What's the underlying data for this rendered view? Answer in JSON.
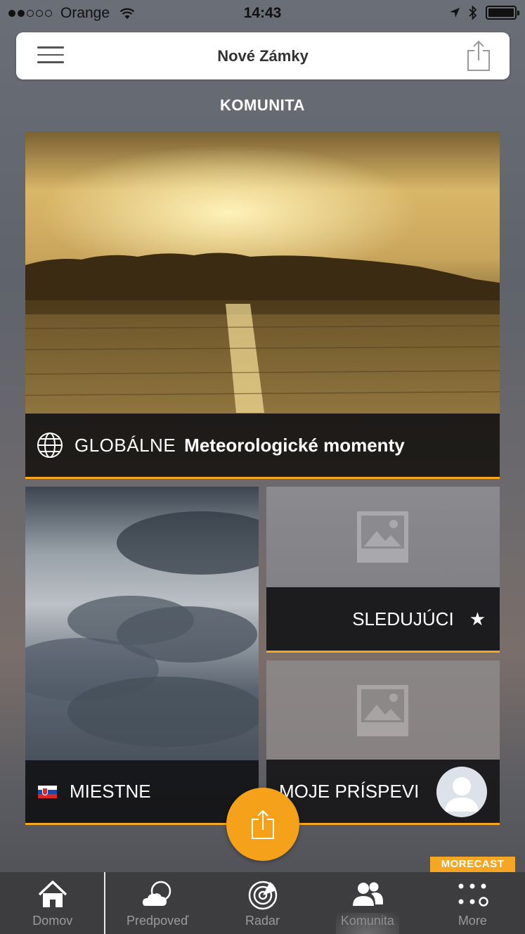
{
  "status_bar": {
    "carrier": "Orange",
    "time": "14:43"
  },
  "header": {
    "title": "Nové Zámky",
    "menu_icon": "hamburger-menu-icon",
    "share_icon": "share-icon"
  },
  "section": {
    "title": "KOMUNITA"
  },
  "tiles": {
    "global": {
      "label": "GLOBÁLNE",
      "subtitle": "Meteorologické momenty"
    },
    "local": {
      "label": "MIESTNE"
    },
    "followers": {
      "label": "SLEDUJÚCI",
      "star": "★"
    },
    "mine": {
      "label": "MOJE PRÍSPEVI"
    }
  },
  "badge": {
    "text": "MORECAST"
  },
  "tabs": [
    {
      "label": "Domov",
      "icon": "home-icon"
    },
    {
      "label": "Predpoveď",
      "icon": "weather-icon"
    },
    {
      "label": "Radar",
      "icon": "radar-icon"
    },
    {
      "label": "Komunita",
      "icon": "community-icon",
      "active": true
    },
    {
      "label": "More",
      "icon": "more-icon"
    }
  ],
  "colors": {
    "accent": "#f5a623",
    "tabbar": "#3d3d40"
  }
}
